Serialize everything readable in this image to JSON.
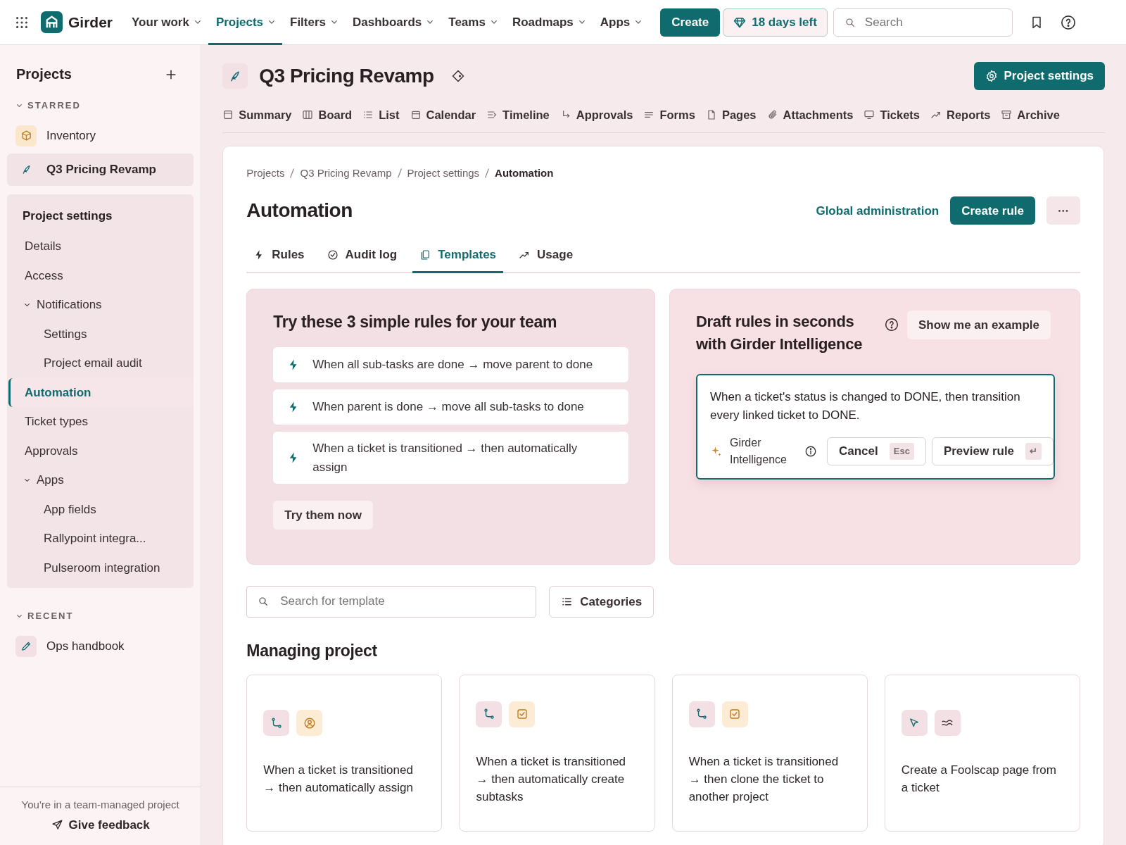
{
  "topnav": {
    "app_name": "Girder",
    "menus": [
      {
        "label": "Your work",
        "selected": false
      },
      {
        "label": "Projects",
        "selected": true
      },
      {
        "label": "Filters",
        "selected": false
      },
      {
        "label": "Dashboards",
        "selected": false
      },
      {
        "label": "Teams",
        "selected": false
      },
      {
        "label": "Roadmaps",
        "selected": false
      },
      {
        "label": "Apps",
        "selected": false
      }
    ],
    "create_button": "Create",
    "trial_button": "18 days left",
    "search": {
      "placeholder": "Search"
    }
  },
  "sidebar": {
    "title": "Projects",
    "starred_heading": "STARRED",
    "starred": [
      {
        "label": "Inventory",
        "selected": false
      },
      {
        "label": "Q3 Pricing Revamp",
        "selected": true
      }
    ],
    "settings": {
      "title": "Project settings",
      "items": [
        {
          "label": "Details",
          "selected": false
        },
        {
          "label": "Access",
          "selected": false
        },
        {
          "label": "Notifications",
          "selected": false,
          "expanded": true,
          "children": [
            {
              "label": "Settings",
              "selected": false
            },
            {
              "label": "Project email audit",
              "selected": false
            }
          ]
        },
        {
          "label": "Automation",
          "selected": true
        },
        {
          "label": "Ticket types",
          "selected": false
        },
        {
          "label": "Approvals",
          "selected": false
        },
        {
          "label": "Apps",
          "selected": false,
          "expanded": true,
          "children": [
            {
              "label": "App fields",
              "selected": false
            },
            {
              "label": "Rallypoint integra...",
              "selected": false
            },
            {
              "label": "Pulseroom integration",
              "selected": false
            }
          ]
        }
      ]
    },
    "recent_heading": "RECENT",
    "recent": [
      {
        "label": "Ops handbook",
        "selected": false
      }
    ],
    "footer_note": "You're in a team-managed project",
    "feedback": "Give feedback"
  },
  "project": {
    "title": "Q3 Pricing Revamp",
    "settings_button": "Project settings",
    "tabs": [
      {
        "label": "Summary",
        "selected": false
      },
      {
        "label": "Board",
        "selected": false
      },
      {
        "label": "List",
        "selected": false
      },
      {
        "label": "Calendar",
        "selected": false
      },
      {
        "label": "Timeline",
        "selected": false
      },
      {
        "label": "Approvals",
        "selected": false
      },
      {
        "label": "Forms",
        "selected": false
      },
      {
        "label": "Pages",
        "selected": false
      },
      {
        "label": "Attachments",
        "selected": false
      },
      {
        "label": "Tickets",
        "selected": false
      },
      {
        "label": "Reports",
        "selected": false
      },
      {
        "label": "Archive",
        "selected": false
      }
    ]
  },
  "page": {
    "breadcrumbs": [
      "Projects",
      "Q3 Pricing Revamp",
      "Project settings",
      "Automation"
    ],
    "title": "Automation",
    "global_admin_link": "Global administration",
    "create_rule_button": "Create rule",
    "tabs": [
      {
        "label": "Rules",
        "selected": false
      },
      {
        "label": "Audit log",
        "selected": false
      },
      {
        "label": "Templates",
        "selected": true
      },
      {
        "label": "Usage",
        "selected": false
      }
    ]
  },
  "suggestions": {
    "title": "Try these 3 simple rules for your team",
    "rules": [
      "When all sub-tasks are done → move parent to done",
      "When parent is done → move all sub-tasks to done",
      "When a ticket is transitioned → then automatically assign"
    ],
    "button": "Try them now"
  },
  "ai_panel": {
    "title": "Draft rules in seconds with Girder Intelligence",
    "example_button": "Show me an example",
    "prompt": "When a ticket's status is changed to DONE, then transition every linked ticket to DONE.",
    "brand": "Girder Intelligence",
    "cancel_button": "Cancel",
    "cancel_key": "Esc",
    "preview_button": "Preview rule",
    "preview_key": "↵"
  },
  "template_search": {
    "placeholder": "Search for template"
  },
  "categories_button": "Categories",
  "section": {
    "title": "Managing project",
    "cards": [
      "When a ticket is transitioned → then automatically assign",
      "When a ticket is transitioned → then automatically create subtasks",
      "When a ticket is transitioned → then clone the ticket to another project",
      "Create a Foolscap page from a ticket"
    ]
  }
}
